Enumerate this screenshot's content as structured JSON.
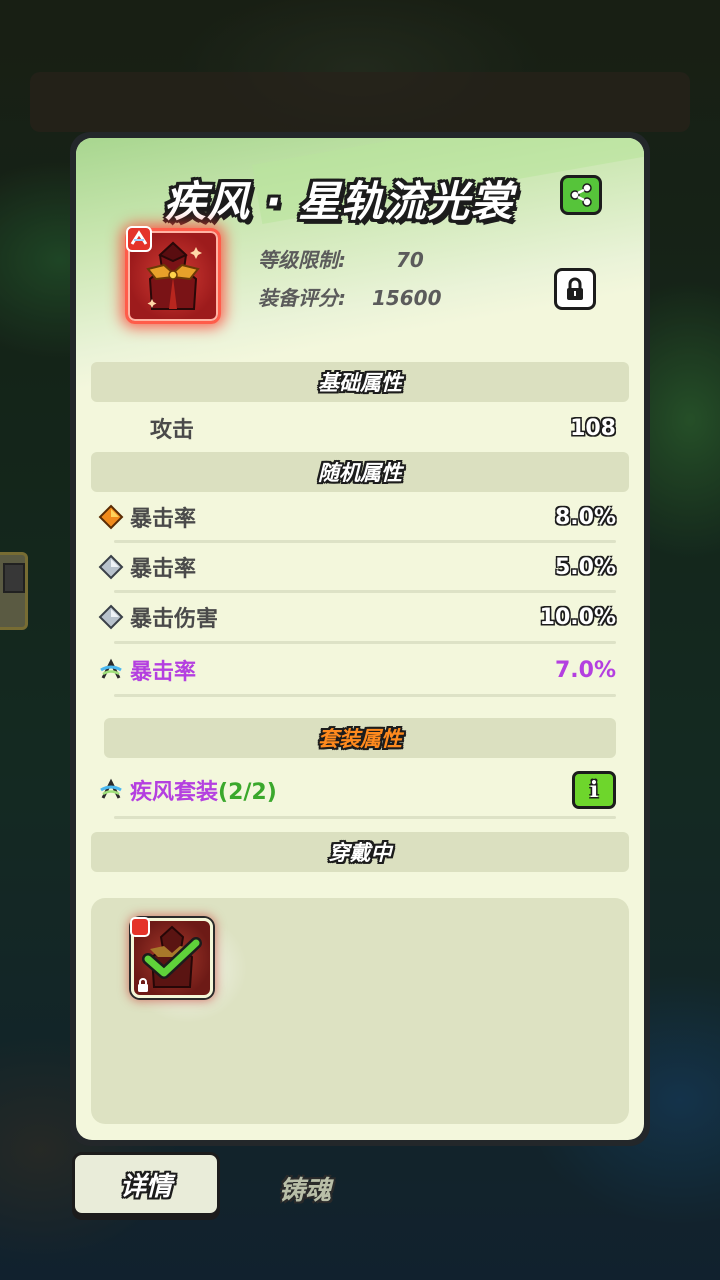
{
  "item": {
    "title": "疾风 · 星轨流光裳",
    "level_label": "等级限制:",
    "level_value": "70",
    "score_label": "装备评分:",
    "score_value": "15600"
  },
  "sections": {
    "base": "基础属性",
    "random": "随机属性",
    "set": "套装属性",
    "wearing": "穿戴中"
  },
  "base_stats": [
    {
      "label": "攻击",
      "value": "108"
    }
  ],
  "random_stats": [
    {
      "icon": "orange-diamond-icon",
      "label": "暴击率",
      "value": "8.0%"
    },
    {
      "icon": "silver-diamond-icon",
      "label": "暴击率",
      "value": "5.0%"
    },
    {
      "icon": "silver-diamond-icon",
      "label": "暴击伤害",
      "value": "10.0%"
    },
    {
      "icon": "wind-set-icon",
      "label": "暴击率",
      "value": "7.0%"
    }
  ],
  "set_bonus": {
    "name": "疾风套装",
    "count": "(2/2)"
  },
  "tabs": {
    "details": "详情",
    "forge_soul": "铸魂"
  },
  "colors": {
    "accent_green": "#56c43a",
    "purple": "#b43fe0",
    "set_orange": "#ff8a1e",
    "panel_bg": "#f3f7dc"
  }
}
